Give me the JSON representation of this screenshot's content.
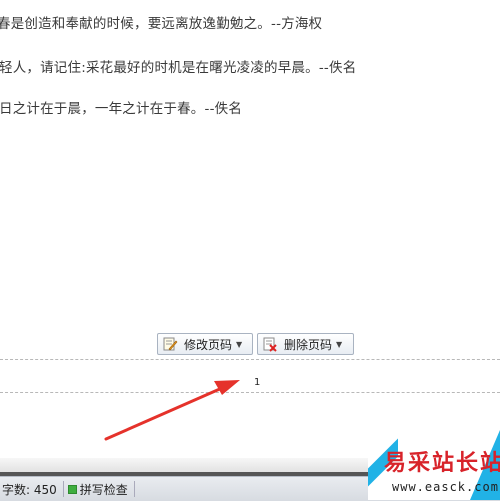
{
  "document": {
    "lines": [
      "春是创造和奉献的时候，要远离放逸勤勉之。--方海权",
      "轻人，请记住:采花最好的时机是在曙光凌凌的早晨。--佚名",
      "日之计在于晨，一年之计在于春。--佚名"
    ],
    "page_number": "1"
  },
  "footer_toolbar": {
    "edit_label": "修改页码",
    "delete_label": "删除页码",
    "edit_icon": "edit-page-icon",
    "delete_icon": "delete-page-icon"
  },
  "statusbar": {
    "word_count": "字数: 450",
    "spell_check_label": "拼写检查"
  },
  "watermark": {
    "title": "易采站长站",
    "url": "www.easck.com"
  },
  "colors": {
    "arrow": "#e5322b",
    "watermark_red": "#d8232a",
    "watermark_blue": "#21b2e6",
    "spell_green": "#3fae3f"
  }
}
